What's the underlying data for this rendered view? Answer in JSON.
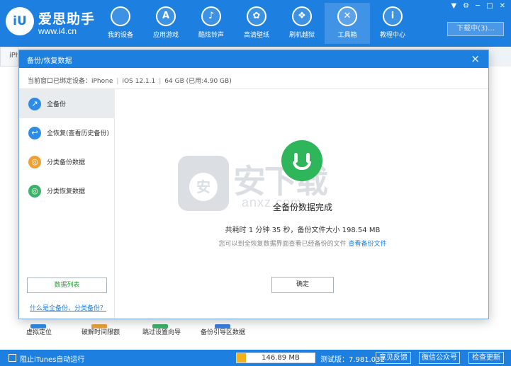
{
  "app": {
    "brand_name": "爱思助手",
    "brand_url": "www.i4.cn",
    "logo_text": "iU"
  },
  "nav": [
    {
      "label": "我的设备",
      "icon": "apple-icon",
      "glyph": ""
    },
    {
      "label": "应用游戏",
      "icon": "app-store-icon",
      "glyph": "A"
    },
    {
      "label": "酷炫铃声",
      "icon": "bell-icon",
      "glyph": "♪"
    },
    {
      "label": "高清壁纸",
      "icon": "flower-icon",
      "glyph": "✿"
    },
    {
      "label": "刷机越狱",
      "icon": "dropbox-icon",
      "glyph": "❖"
    },
    {
      "label": "工具箱",
      "icon": "tools-icon",
      "glyph": "✕"
    },
    {
      "label": "教程中心",
      "icon": "info-icon",
      "glyph": "i"
    }
  ],
  "window_controls": {
    "pin": "▼",
    "settings": "⚙",
    "minimize": "─",
    "maximize": "□",
    "close": "✕"
  },
  "download_button": "下载中(3)...",
  "device_tab": "iPh",
  "background_tools": [
    {
      "label": "虚拟定位",
      "color": "#2f8be6"
    },
    {
      "label": "破解时间限额",
      "color": "#e8a23a"
    },
    {
      "label": "跳过设置向导",
      "color": "#3bb26a"
    },
    {
      "label": "备份引导区数据",
      "color": "#3b7fe0"
    }
  ],
  "dialog": {
    "title": "备份/恢复数据",
    "close": "×",
    "device_bar": {
      "label": "当前窗口已绑定设备：iPhone",
      "ios": "iOS 12.1.1",
      "storage": "64 GB (已用:4.90 GB)"
    },
    "sidebar": {
      "items": [
        {
          "label": "全备份",
          "color": "#2f8be6",
          "glyph": "↗"
        },
        {
          "label": "全恢复(查看历史备份)",
          "color": "#2f8be6",
          "glyph": "↩"
        },
        {
          "label": "分类备份数据",
          "color": "#f0a136",
          "glyph": "◎"
        },
        {
          "label": "分类恢复数据",
          "color": "#3bb26a",
          "glyph": "◎"
        }
      ],
      "data_list_button": "数据列表",
      "help_link": "什么是全备份、分类备份？"
    },
    "main": {
      "watermark_cn": "安下载",
      "watermark_en": "anxz.com",
      "watermark_badge": "安",
      "done_title": "全备份数据完成",
      "done_detail": "共耗时 1 分钟 35 秒，备份文件大小 198.54 MB",
      "hint_text": "您可以到全恢复数据界面查看已经备份的文件",
      "hint_link": "查看备份文件",
      "confirm_button": "确定"
    }
  },
  "statusbar": {
    "itunes_label": "阻止iTunes自动运行",
    "free_space": "146.89 MB",
    "storage_used_fraction": 0.12,
    "version": "测试版：7.981.032",
    "feedback": "意见反馈",
    "wechat": "微信公众号",
    "update": "检查更新"
  },
  "colors": {
    "primary": "#1d7fe0",
    "success": "#2fb55a",
    "storage_fill": "#f2b21b"
  }
}
